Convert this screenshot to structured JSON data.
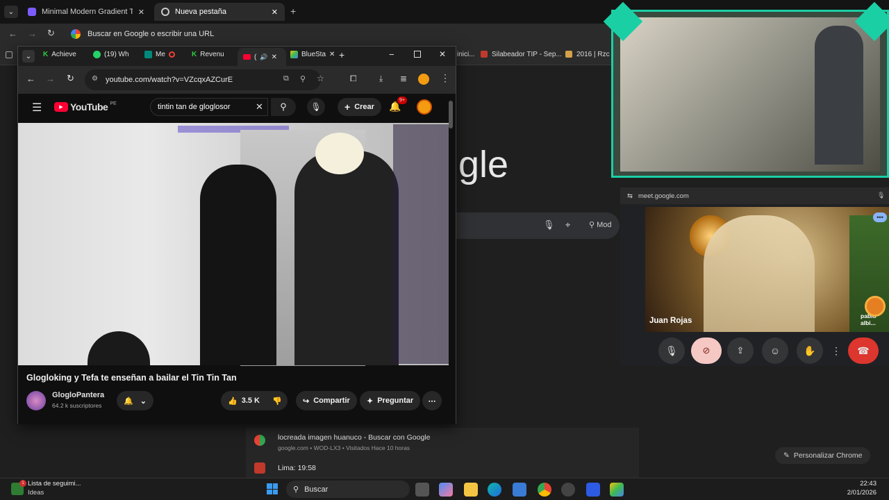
{
  "back_browser": {
    "tabs": [
      {
        "title": "Minimal Modern Gradient The"
      },
      {
        "title": "Nueva pestaña"
      }
    ],
    "omnibox_placeholder": "Buscar en Google o escribir una URL",
    "bookmarks": [
      {
        "label": "inici..."
      },
      {
        "label": "Silabeador TIP - Sep..."
      },
      {
        "label": "2016 | Rzc"
      }
    ],
    "logo_partial": "gle",
    "search_hint": "Mod",
    "history": [
      {
        "title": "locreada imagen huanuco - Buscar con Google",
        "meta": "google.com • WOD-LX3 • Visitados Hace 10 horas"
      },
      {
        "title": "Lima: 19:58",
        "meta": ""
      }
    ],
    "customize_label": "Personalizar Chrome"
  },
  "yt_window": {
    "tabs": [
      {
        "title": "Achieve"
      },
      {
        "title": "(19) Wh"
      },
      {
        "title": "Me"
      },
      {
        "title": "Revenu"
      },
      {
        "title": "("
      },
      {
        "title": "BlueSta"
      }
    ],
    "url": "youtube.com/watch?v=VZcqxAZCurE",
    "youtube": {
      "logo_text": "YouTube",
      "country": "PE",
      "search_value": "tintin tan de gloglosor",
      "create_label": "Crear",
      "notif_count": "9+",
      "video_title": "Glogloking y Tefa te enseñan a bailar el Tin Tin Tan",
      "channel_name": "GlogloPantera",
      "subscribers": "64.2 k suscriptores",
      "likes": "3.5 K",
      "share_label": "Compartir",
      "ask_label": "Preguntar"
    }
  },
  "meet": {
    "domain": "meet.google.com",
    "participant_name": "Juan Rojas",
    "other_participant": "pablo albi..."
  },
  "taskbar": {
    "widget_title": "Lista de seguimi...",
    "widget_sub": "Ideas",
    "search_label": "Buscar",
    "time": "22:43",
    "date": "2/01/2026"
  }
}
